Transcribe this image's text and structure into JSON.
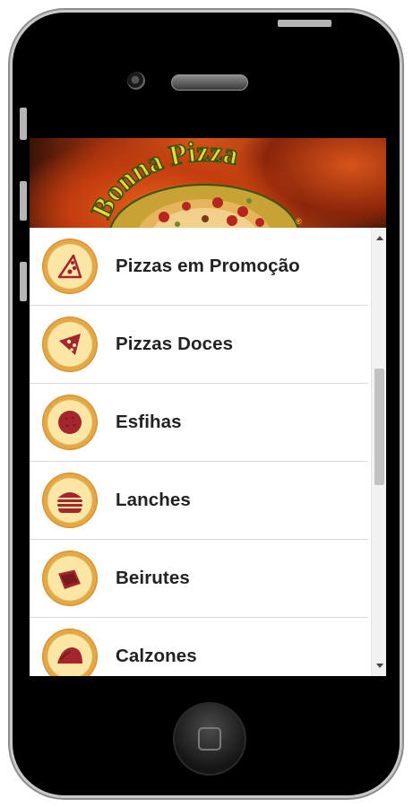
{
  "app": {
    "banner_brand": "Bonna Pizza",
    "banner_mark": "®"
  },
  "menu": {
    "items": [
      {
        "label": "Pizzas em Promoção",
        "icon": "pizza-slice-outline-icon"
      },
      {
        "label": "Pizzas Doces",
        "icon": "pizza-slice-icon"
      },
      {
        "label": "Esfihas",
        "icon": "esfiha-icon"
      },
      {
        "label": "Lanches",
        "icon": "burger-icon"
      },
      {
        "label": "Beirutes",
        "icon": "beirute-sandwich-icon"
      },
      {
        "label": "Calzones",
        "icon": "calzone-icon"
      }
    ]
  },
  "colors": {
    "icon_ring": "#d78a2a",
    "icon_fill": "#fbe6a6",
    "food_red": "#a4262c",
    "brand_text": "#f3d43a",
    "brand_stroke": "#2b5a12"
  }
}
